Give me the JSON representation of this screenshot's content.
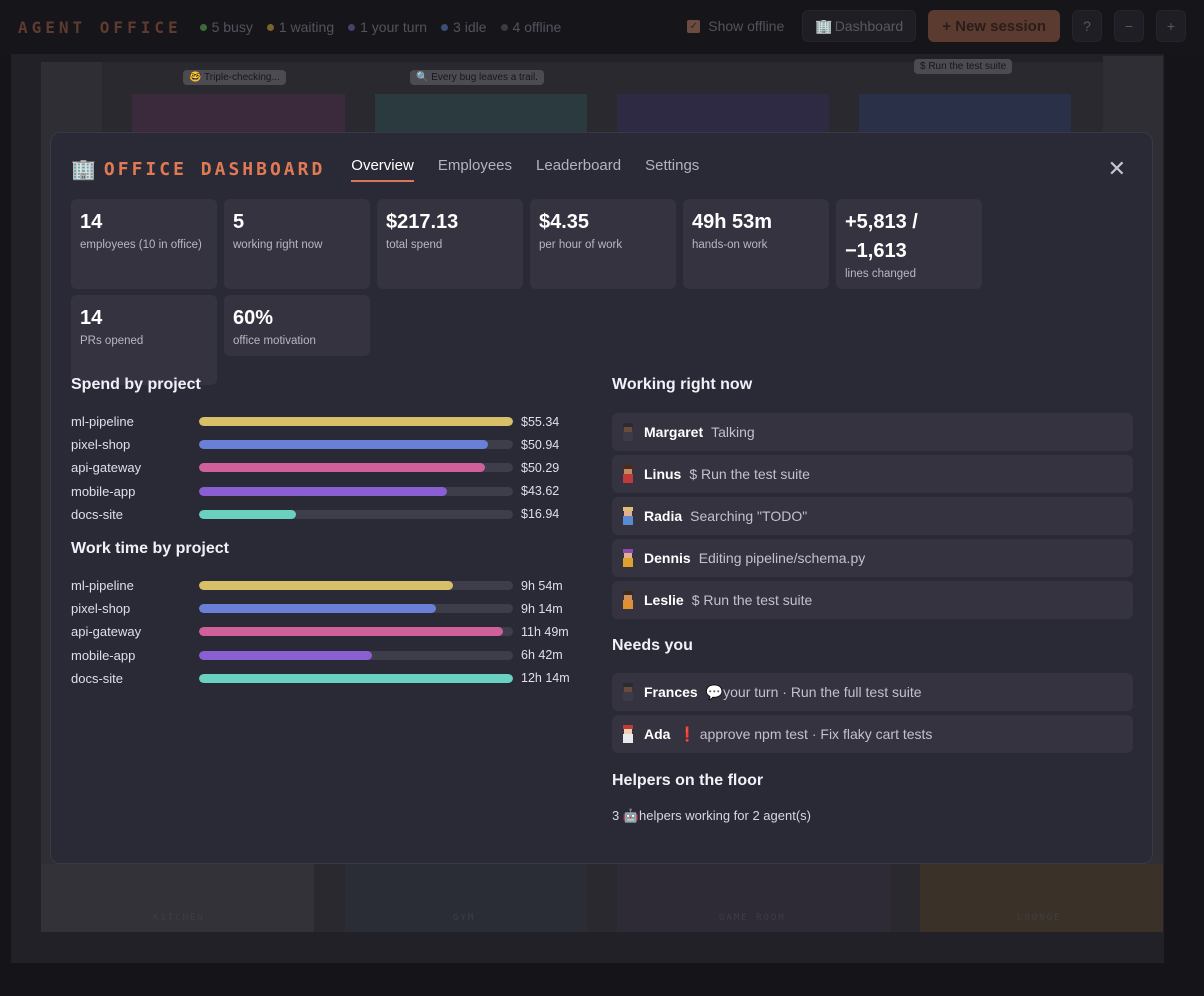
{
  "app": {
    "title": "AGENT OFFICE"
  },
  "status": [
    {
      "label": "5 busy",
      "color": "#3f6b3a"
    },
    {
      "label": "1 waiting",
      "color": "#7a6326"
    },
    {
      "label": "1 your turn",
      "color": "#4d3d6f"
    },
    {
      "label": "3 idle",
      "color": "#3a4f75"
    },
    {
      "label": "4 offline",
      "color": "#3c3b42"
    }
  ],
  "toolbar": {
    "show_offline_label": "Show offline",
    "dashboard_label": "Dashboard",
    "new_session_label": "+ New session",
    "help_label": "?",
    "zoom_out_label": "−",
    "zoom_in_label": "+"
  },
  "floor": {
    "bubbles": [
      "🤓 Triple-checking...",
      "🔍 Every bug leaves a trail.",
      "$ Run the test suite"
    ],
    "rooms": [
      "KITCHEN",
      "GYM",
      "GAME ROOM",
      "LOUNGE"
    ]
  },
  "dashboard": {
    "title": "OFFICE DASHBOARD",
    "tabs": [
      "Overview",
      "Employees",
      "Leaderboard",
      "Settings"
    ],
    "active_tab": "Overview",
    "close_label": "✕",
    "stats": [
      {
        "value": "14",
        "label": "employees (10 in office)"
      },
      {
        "value": "5",
        "label": "working right now"
      },
      {
        "value": "$217.13",
        "label": "total spend"
      },
      {
        "value": "$4.35",
        "label": "per hour of work"
      },
      {
        "value": "49h 53m",
        "label": "hands-on work"
      },
      {
        "value": "+5,813 / −1,613",
        "label": "lines changed"
      },
      {
        "value": "14",
        "label": "PRs opened"
      },
      {
        "value": "60%",
        "label": "office motivation"
      }
    ],
    "spend_title": "Spend by project",
    "spend": [
      {
        "name": "ml-pipeline",
        "value": "$55.34",
        "fraction": 1.0,
        "color": "#d7c068"
      },
      {
        "name": "pixel-shop",
        "value": "$50.94",
        "fraction": 0.92,
        "color": "#6a7fd6"
      },
      {
        "name": "api-gateway",
        "value": "$50.29",
        "fraction": 0.91,
        "color": "#d0609a"
      },
      {
        "name": "mobile-app",
        "value": "$43.62",
        "fraction": 0.79,
        "color": "#8a5fd2"
      },
      {
        "name": "docs-site",
        "value": "$16.94",
        "fraction": 0.31,
        "color": "#6ad0bf"
      }
    ],
    "worktime_title": "Work time by project",
    "worktime": [
      {
        "name": "ml-pipeline",
        "value": "9h 54m",
        "fraction": 0.81,
        "color": "#d7c068"
      },
      {
        "name": "pixel-shop",
        "value": "9h 14m",
        "fraction": 0.755,
        "color": "#6a7fd6"
      },
      {
        "name": "api-gateway",
        "value": "11h 49m",
        "fraction": 0.968,
        "color": "#d0609a"
      },
      {
        "name": "mobile-app",
        "value": "6h 42m",
        "fraction": 0.55,
        "color": "#8a5fd2"
      },
      {
        "name": "docs-site",
        "value": "12h 14m",
        "fraction": 1.0,
        "color": "#6ad0bf"
      }
    ],
    "working_title": "Working right now",
    "working": [
      {
        "name": "Margaret",
        "activity": "Talking",
        "hair": "#2a2a35",
        "face": "#6a4a3a",
        "shirt": "#3b3b4a"
      },
      {
        "name": "Linus",
        "activity": "$ Run the test suite",
        "hair": "#4a2a1a",
        "face": "#c08a60",
        "shirt": "#c03a3a"
      },
      {
        "name": "Radia",
        "activity": "Searching \"TODO\"",
        "hair": "#e0c070",
        "face": "#e0b090",
        "shirt": "#5a8ad0"
      },
      {
        "name": "Dennis",
        "activity": "Editing pipeline/schema.py",
        "hair": "#8a4ab0",
        "face": "#e0b090",
        "shirt": "#e0a030"
      },
      {
        "name": "Leslie",
        "activity": "$ Run the test suite",
        "hair": "#3a2a1a",
        "face": "#d09060",
        "shirt": "#e09030"
      }
    ],
    "needs_title": "Needs you",
    "needs": [
      {
        "name": "Frances",
        "activity": "💬your turn · Run the full test suite",
        "hair": "#2a2a35",
        "face": "#6a4a3a",
        "shirt": "#3b3b4a"
      },
      {
        "name": "Ada",
        "activity": "❗ approve npm test · Fix flaky cart tests",
        "hair": "#c03a3a",
        "face": "#f0d0b0",
        "shirt": "#e8e8ee"
      }
    ],
    "helpers_title": "Helpers on the floor",
    "helpers_text": "3 🤖helpers working for 2 agent(s)"
  }
}
